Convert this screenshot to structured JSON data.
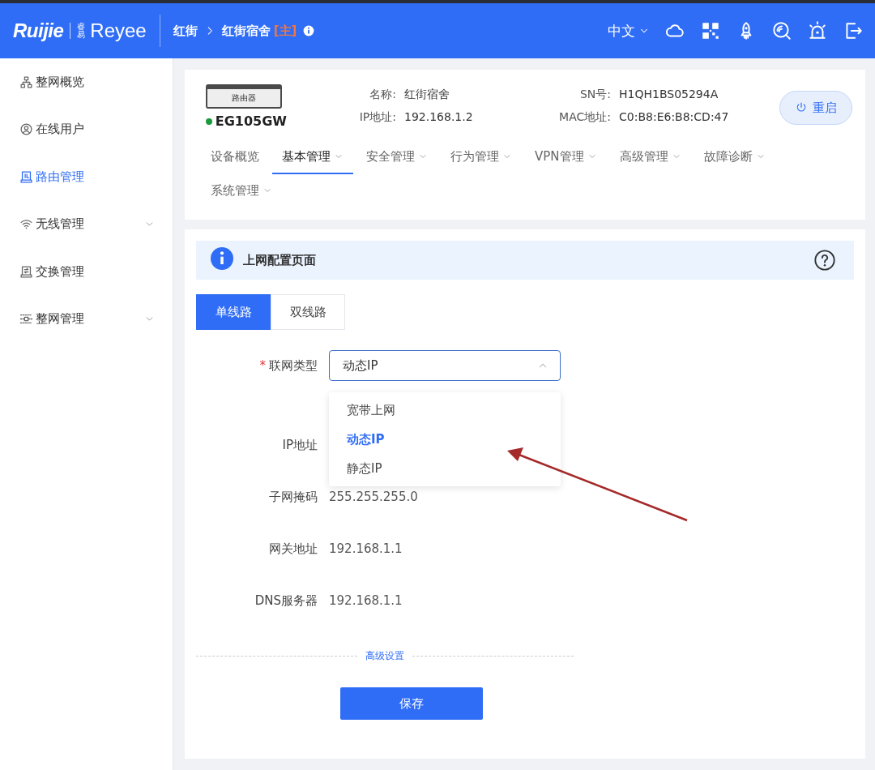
{
  "header": {
    "logo": "Ruijie",
    "sublogo_mark": "睿易",
    "sublogo": "Reyee",
    "breadcrumb": [
      {
        "text": "红街"
      },
      {
        "text": "红街宿舍"
      }
    ],
    "role_tag": "[主]",
    "language": "中文"
  },
  "sidebar": {
    "items": [
      {
        "label": "整网概览",
        "kind": "link",
        "selected": false
      },
      {
        "label": "在线用户",
        "kind": "link",
        "selected": false
      },
      {
        "label": "路由管理",
        "kind": "link",
        "selected": true
      },
      {
        "label": "无线管理",
        "kind": "group",
        "selected": false
      },
      {
        "label": "交换管理",
        "kind": "link",
        "selected": false
      },
      {
        "label": "整网管理",
        "kind": "group",
        "selected": false
      }
    ]
  },
  "device": {
    "image_label": "路由器",
    "model": "EG105GW",
    "online": true,
    "info": [
      {
        "label": "名称:",
        "value": "红街宿舍"
      },
      {
        "label": "SN号:",
        "value": "H1QH1BS05294A"
      },
      {
        "label": "IP地址:",
        "value": "192.168.1.2"
      },
      {
        "label": "MAC地址:",
        "value": "C0:B8:E6:B8:CD:47"
      }
    ],
    "restart": "重启"
  },
  "tabs": [
    {
      "label": "设备概览",
      "kind": "plain",
      "selected": false
    },
    {
      "label": "基本管理",
      "kind": "menu",
      "selected": true
    },
    {
      "label": "安全管理",
      "kind": "menu",
      "selected": false
    },
    {
      "label": "行为管理",
      "kind": "menu",
      "selected": false
    },
    {
      "label": "VPN管理",
      "kind": "menu",
      "selected": false
    },
    {
      "label": "高级管理",
      "kind": "menu",
      "selected": false
    },
    {
      "label": "故障诊断",
      "kind": "menu",
      "selected": false
    },
    {
      "label": "系统管理",
      "kind": "menu",
      "selected": false
    }
  ],
  "notice": {
    "title": "上网配置页面"
  },
  "line_tabs": [
    {
      "label": "单线路",
      "selected": true
    },
    {
      "label": "双线路",
      "selected": false
    }
  ],
  "form": {
    "fields": [
      {
        "kind": "select",
        "label": "联网类型",
        "required_mark": "*",
        "value": "动态IP",
        "options": [
          {
            "label": "宽带上网",
            "selected": false
          },
          {
            "label": "动态IP",
            "selected": true
          },
          {
            "label": "静态IP",
            "selected": false
          }
        ]
      },
      {
        "kind": "text",
        "label": "IP地址"
      },
      {
        "kind": "text",
        "label": "子网掩码",
        "value": "255.255.255.0"
      },
      {
        "kind": "text",
        "label": "网关地址",
        "value": "192.168.1.1"
      },
      {
        "kind": "text",
        "label": "DNS服务器",
        "value": "192.168.1.1"
      }
    ],
    "advanced": "高级设置",
    "save": "保存"
  }
}
